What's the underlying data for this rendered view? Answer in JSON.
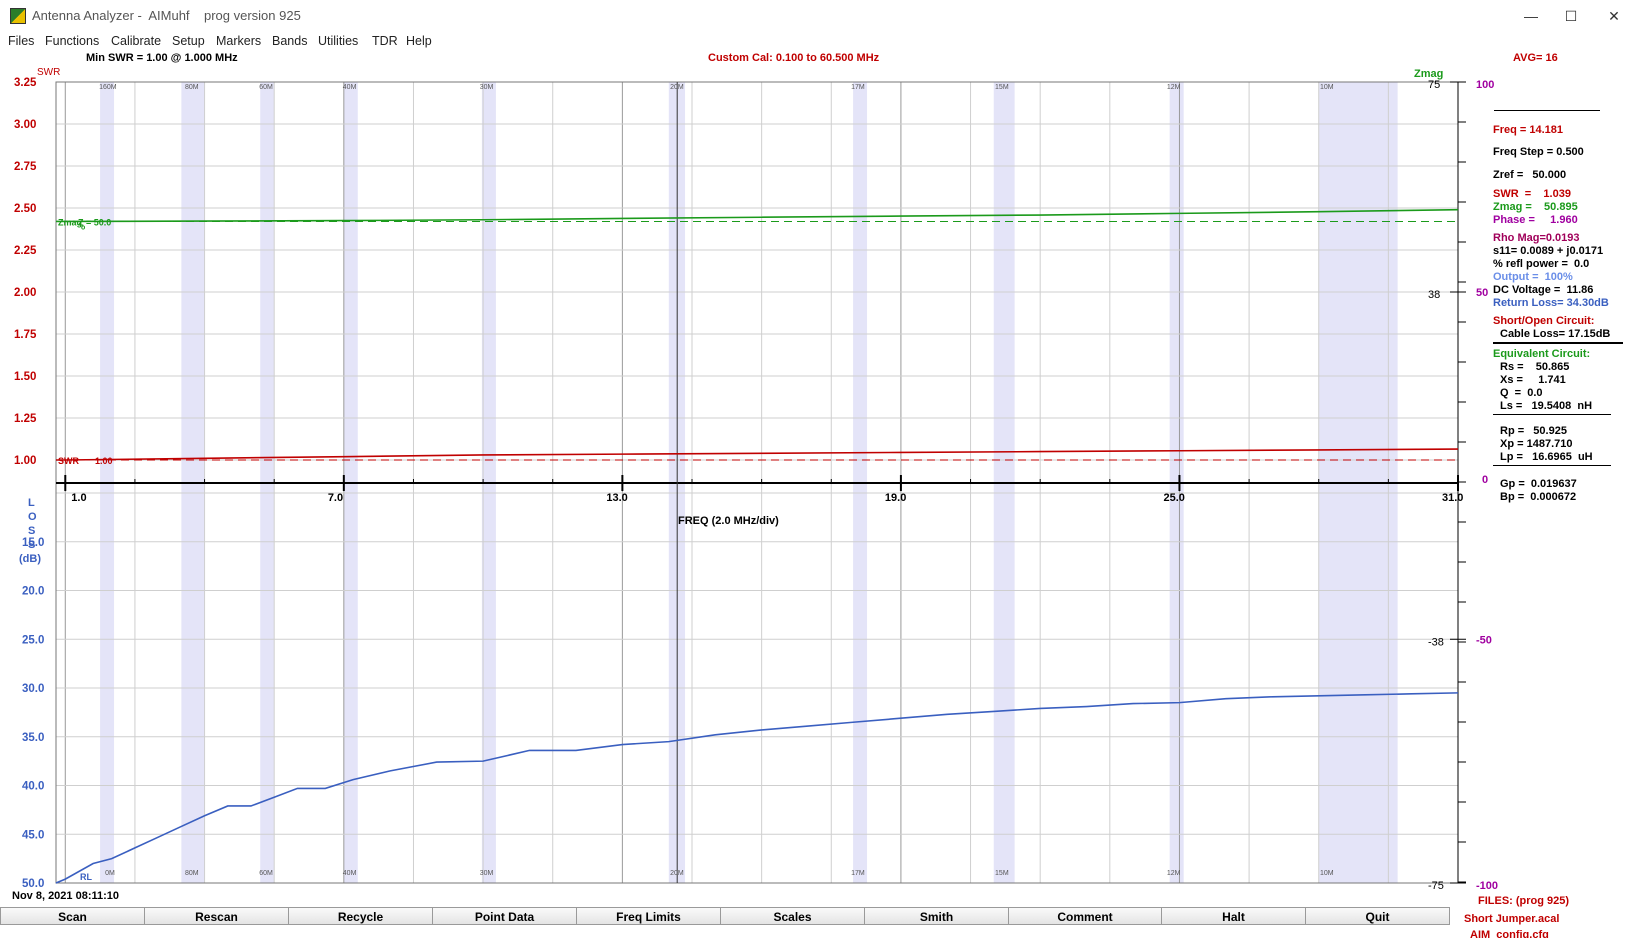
{
  "window": {
    "title": "Antenna Analyzer -  AIMuhf    prog version 925",
    "minimize": "—",
    "maximize": "☐",
    "close": "✕"
  },
  "menu": [
    "Files",
    "Functions",
    "Calibrate",
    "Setup",
    "Markers",
    "Bands",
    "Utilities",
    "TDR",
    "Help"
  ],
  "header": {
    "min_swr": "Min SWR =    1.00 @   1.000 MHz",
    "custom_cal": "Custom Cal:  0.100 to 60.500 MHz",
    "avg": "AVG=  16"
  },
  "axes": {
    "swr_title": "SWR",
    "zmag_title": "Zmag",
    "swr_ticks": [
      "3.25",
      "3.00",
      "2.75",
      "2.50",
      "2.25",
      "2.00",
      "1.75",
      "1.50",
      "1.25",
      "1.00"
    ],
    "freq_ticks": [
      "1.0",
      "7.0",
      "13.0",
      "19.0",
      "25.0",
      "31.0"
    ],
    "freq_label": "FREQ (2.0 MHz/div)",
    "loss_title": [
      "L",
      "O",
      "S",
      "S",
      "(dB)"
    ],
    "loss_ticks": [
      "15.0",
      "20.0",
      "25.0",
      "30.0",
      "35.0",
      "40.0",
      "45.0",
      "50.0"
    ],
    "zmag_inner_ticks": [
      "75",
      "38",
      "-38",
      "-75"
    ],
    "phase_ticks": [
      "100",
      "50",
      "0",
      "-50",
      "-100"
    ],
    "band_labels_top": [
      "160M",
      "80M",
      "60M",
      "40M",
      "30M",
      "20M",
      "17M",
      "15M",
      "12M",
      "10M"
    ],
    "band_labels_bottom": [
      "0M",
      "80M",
      "60M",
      "40M",
      "30M",
      "20M",
      "17M",
      "15M",
      "12M",
      "10M"
    ],
    "zmag_marker": "Zmag",
    "zo_marker": "Z  = 50.0",
    "zo_sub": "o",
    "swr_marker": "SWR",
    "swr_marker_value": "1.00",
    "rl_marker": "RL"
  },
  "chart_data": {
    "type": "line",
    "x_label": "FREQ (2.0 MHz/div)",
    "xlim": [
      0.8,
      31.0
    ],
    "series": [
      {
        "name": "SWR",
        "color": "#c00000",
        "x": [
          0.8,
          1,
          4,
          7,
          10,
          13,
          16,
          19,
          22,
          25,
          28,
          31
        ],
        "values": [
          1.0,
          1.0,
          1.01,
          1.02,
          1.03,
          1.035,
          1.04,
          1.045,
          1.05,
          1.055,
          1.06,
          1.065
        ],
        "ylim": [
          1.0,
          3.25
        ]
      },
      {
        "name": "Zmag",
        "color": "#1b9a1b",
        "x": [
          0.8,
          4,
          7,
          10,
          13,
          16,
          19,
          22,
          25,
          28,
          31
        ],
        "values": [
          2.42,
          2.422,
          2.425,
          2.43,
          2.438,
          2.445,
          2.452,
          2.458,
          2.468,
          2.478,
          2.49
        ],
        "ylim": [
          1.0,
          3.25
        ]
      },
      {
        "name": "Return Loss",
        "color": "#3a5fc0",
        "x": [
          0.8,
          1,
          1.6,
          2,
          2.5,
          3,
          3.5,
          4,
          4.5,
          5,
          5.5,
          6,
          6.6,
          7.2,
          8,
          9,
          10,
          11,
          12,
          13,
          14,
          15,
          16,
          17,
          18,
          19,
          20,
          21,
          22,
          23,
          24,
          25,
          26,
          27,
          28,
          29,
          30,
          31
        ],
        "values": [
          50,
          49.6,
          48,
          47.5,
          46.4,
          45.3,
          44.2,
          43.1,
          42.1,
          42.1,
          41.2,
          40.3,
          40.3,
          39.4,
          38.5,
          37.6,
          37.5,
          36.4,
          36.4,
          35.8,
          35.5,
          34.8,
          34.3,
          33.9,
          33.5,
          33.1,
          32.7,
          32.4,
          32.1,
          31.9,
          31.6,
          31.5,
          31.1,
          30.9,
          30.8,
          30.7,
          30.6,
          30.5
        ],
        "ylim": [
          10,
          50
        ]
      }
    ],
    "bands": [
      [
        1.8,
        2.0
      ],
      [
        3.5,
        4.0
      ],
      [
        5.3,
        5.4
      ],
      [
        7.0,
        7.3
      ],
      [
        10.1,
        10.15
      ],
      [
        14.0,
        14.35
      ],
      [
        18.07,
        18.17
      ],
      [
        21.0,
        21.45
      ],
      [
        24.89,
        24.99
      ],
      [
        28.0,
        29.7
      ]
    ],
    "cursor_freq": 14.181
  },
  "readout": {
    "freq": "Freq = 14.181",
    "freq_step": "Freq Step = 0.500",
    "zref": "Zref =   50.000",
    "swr": "SWR  =    1.039",
    "zmag": "Zmag =    50.895",
    "phase": "Phase =     1.960",
    "rho_mag": "Rho Mag=0.0193",
    "s11": "s11= 0.0089 + j0.0171",
    "refl_power": "% refl power =  0.0",
    "output": "Output =  100%",
    "dc_voltage": "DC Voltage =  11.86",
    "return_loss": "Return Loss= 34.30dB",
    "short_open": "Short/Open Circuit:",
    "cable_loss": "Cable Loss= 17.15dB",
    "equiv_circuit": "Equivalent Circuit:",
    "rs": "Rs =    50.865",
    "xs": "Xs =     1.741",
    "q": "Q  =  0.0",
    "ls": "Ls =   19.5408  nH",
    "rp": "Rp =   50.925",
    "xp": "Xp = 1487.710",
    "lp": "Lp =   16.6965  uH",
    "gp": "Gp =  0.019637",
    "bp": "Bp =  0.000672"
  },
  "footer": {
    "timestamp": "Nov 8, 2021   08:11:10",
    "files": "FILES:  (prog 925)",
    "cal_file": "Short Jumper.acal",
    "cfg_file": "AIM_config.cfg"
  },
  "buttons": [
    "Scan",
    "Rescan",
    "Recycle",
    "Point Data",
    "Freq Limits",
    "Scales",
    "Smith",
    "Comment",
    "Halt",
    "Quit"
  ],
  "colors": {
    "swr": "#c00000",
    "zmag": "#1b9a1b",
    "loss": "#3a5fc0",
    "phase": "#a000a0",
    "band_shade": "#e4e4f8"
  }
}
